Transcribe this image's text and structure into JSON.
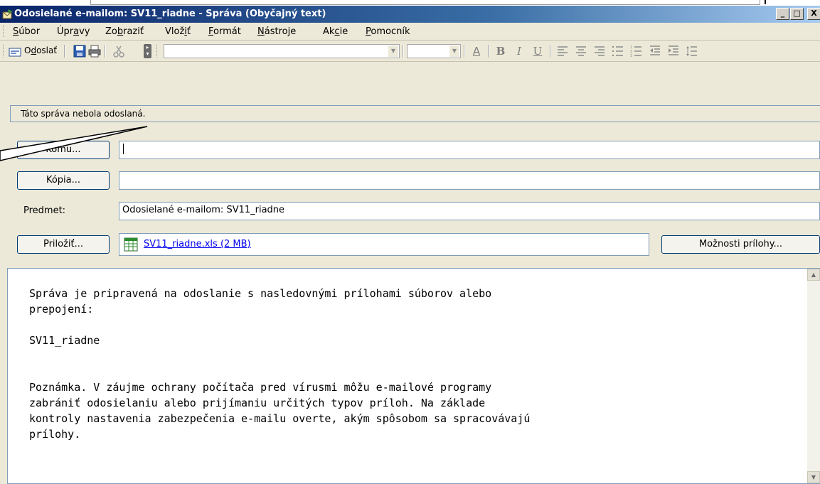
{
  "window": {
    "title": "Odosielané e-mailom: SV11_riadne - Správa (Obyčajný text)",
    "controls": {
      "minimize": "_",
      "maximize": "□",
      "close": "X"
    }
  },
  "menu": [
    {
      "pre": "",
      "u": "S",
      "post": "úbor"
    },
    {
      "pre": "Úpr",
      "u": "a",
      "post": "vy"
    },
    {
      "pre": "Zo",
      "u": "b",
      "post": "raziť"
    },
    {
      "pre": "Vlož",
      "u": "i",
      "post": "ť"
    },
    {
      "pre": "",
      "u": "F",
      "post": "ormát"
    },
    {
      "pre": "",
      "u": "N",
      "post": "ástroje"
    },
    {
      "pre": "Ak",
      "u": "c",
      "post": "ie"
    },
    {
      "pre": "",
      "u": "P",
      "post": "omocník"
    }
  ],
  "toolbar": {
    "send": {
      "pre": "O",
      "u": "d",
      "post": "oslať"
    },
    "font_value": "",
    "size_value": "",
    "format_buttons": [
      "A",
      "B",
      "I",
      "U"
    ],
    "icons": [
      "send-icon",
      "save-icon",
      "print-icon",
      "cut-icon",
      "toolbar-options-icon",
      "font-color-icon",
      "bold-icon",
      "italic-icon",
      "underline-icon",
      "align-left-icon",
      "align-center-icon",
      "align-right-icon",
      "bullets-icon",
      "numbering-icon",
      "decrease-indent-icon",
      "increase-indent-icon",
      "line-spacing-icon"
    ]
  },
  "infobar": {
    "text": "Táto správa nebola odoslaná."
  },
  "fields": {
    "to": {
      "button": "Komu...",
      "value": ""
    },
    "cc": {
      "button": "Kópia...",
      "value": ""
    },
    "subject": {
      "label": "Predmet:",
      "value": "Odosielané e-mailom: SV11_riadne"
    },
    "attach": {
      "button": "Priložiť...",
      "file": "SV11_riadne.xls (2 MB)",
      "options_button": "Možnosti prílohy..."
    }
  },
  "body": {
    "text": "Správa je pripravená na odoslanie s nasledovnými prílohami súborov alebo\nprepojení:\n\nSV11_riadne\n\n\nPoznámka. V záujme ochrany počítača pred vírusmi môžu e-mailové programy\nzabrániť odosielaniu alebo prijímaniu určitých typov príloh. Na základe\nkontroly nastavenia zabezpečenia e-mailu overte, akým spôsobom sa spracovávajú\nprílohy."
  },
  "colors": {
    "titlebar_start": "#0a246a",
    "titlebar_end": "#a6caf0",
    "window_bg": "#ece9d8",
    "link": "#0000ee"
  }
}
